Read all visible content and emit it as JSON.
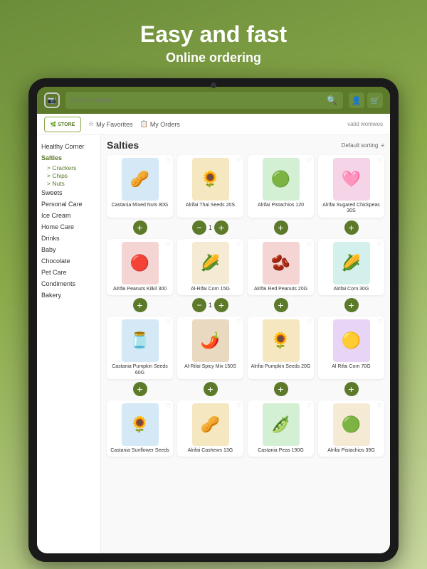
{
  "header": {
    "title": "Easy and fast",
    "subtitle": "Online ordering"
  },
  "topbar": {
    "search_placeholder": "search items",
    "btn1": "👤",
    "btn2": "🛒"
  },
  "secondbar": {
    "logo": "🌿 STORE",
    "favorites": "My Favorites",
    "orders": "My Orders",
    "valid": "valid womwos"
  },
  "sidebar": {
    "items": [
      {
        "label": "Healthy Corner",
        "active": false
      },
      {
        "label": "Salties",
        "active": true
      },
      {
        "label": "Crackers",
        "sub": true
      },
      {
        "label": "Chips",
        "sub": true
      },
      {
        "label": "Nuts",
        "sub": true
      },
      {
        "label": "Sweets",
        "active": false
      },
      {
        "label": "Personal Care",
        "active": false
      },
      {
        "label": "Ice Cream",
        "active": false
      },
      {
        "label": "Home Care",
        "active": false
      },
      {
        "label": "Drinks",
        "active": false
      },
      {
        "label": "Baby",
        "active": false
      },
      {
        "label": "Chocolate",
        "active": false
      },
      {
        "label": "Pet Care",
        "active": false
      },
      {
        "label": "Condiments",
        "active": false
      },
      {
        "label": "Bakery",
        "active": false
      }
    ]
  },
  "section": {
    "title": "Salties",
    "sort": "Default sorting"
  },
  "products_row1": [
    {
      "name": "Castania Mixed Nuts 80G",
      "emoji": "🥜",
      "bg": "product-bg-blue"
    },
    {
      "name": "Alrifai Thai Seeds 20S",
      "emoji": "🌻",
      "bg": "product-bg-gold"
    },
    {
      "name": "Alrifai Pistachios 120",
      "emoji": "🟢",
      "bg": "product-bg-green"
    },
    {
      "name": "Alrifai Sugared Chickpeas 30S",
      "emoji": "🩷",
      "bg": "product-bg-pink"
    }
  ],
  "products_row2": [
    {
      "name": "Alrifai Peanuts Kilkil 300",
      "emoji": "🔴",
      "bg": "product-bg-red"
    },
    {
      "name": "Al-Rifai Corn 15G",
      "emoji": "🌽",
      "bg": "product-bg-orange"
    },
    {
      "name": "Alrifai Red Peanuts 20G",
      "emoji": "🫘",
      "bg": "product-bg-red"
    },
    {
      "name": "Alrifai Corn 30G",
      "emoji": "🌽",
      "bg": "product-bg-teal"
    }
  ],
  "products_row3": [
    {
      "name": "Castania Pumpkin Seeds 60G",
      "emoji": "🫙",
      "bg": "product-bg-blue"
    },
    {
      "name": "Al-Rifai Spicy Mix 150S",
      "emoji": "🌶️",
      "bg": "product-bg-brown"
    },
    {
      "name": "Alrifai Pumpkin Seeds 20G",
      "emoji": "🌻",
      "bg": "product-bg-gold"
    },
    {
      "name": "Al Rifai Corn 70G",
      "emoji": "🟡",
      "bg": "product-bg-purple"
    }
  ],
  "products_row4": [
    {
      "name": "Castania Sunflower Seeds",
      "emoji": "🌻",
      "bg": "product-bg-blue"
    },
    {
      "name": "Alrifai Cashews 13G",
      "emoji": "🥜",
      "bg": "product-bg-gold"
    },
    {
      "name": "Castania Peas 190G",
      "emoji": "🫛",
      "bg": "product-bg-green"
    },
    {
      "name": "Alrifai Pistachios 39G",
      "emoji": "🟢",
      "bg": "product-bg-orange"
    }
  ],
  "qty_row1": {
    "show_qty": true,
    "qty": "1"
  },
  "qty_row2": {
    "show_qty": true,
    "qty": "1"
  }
}
